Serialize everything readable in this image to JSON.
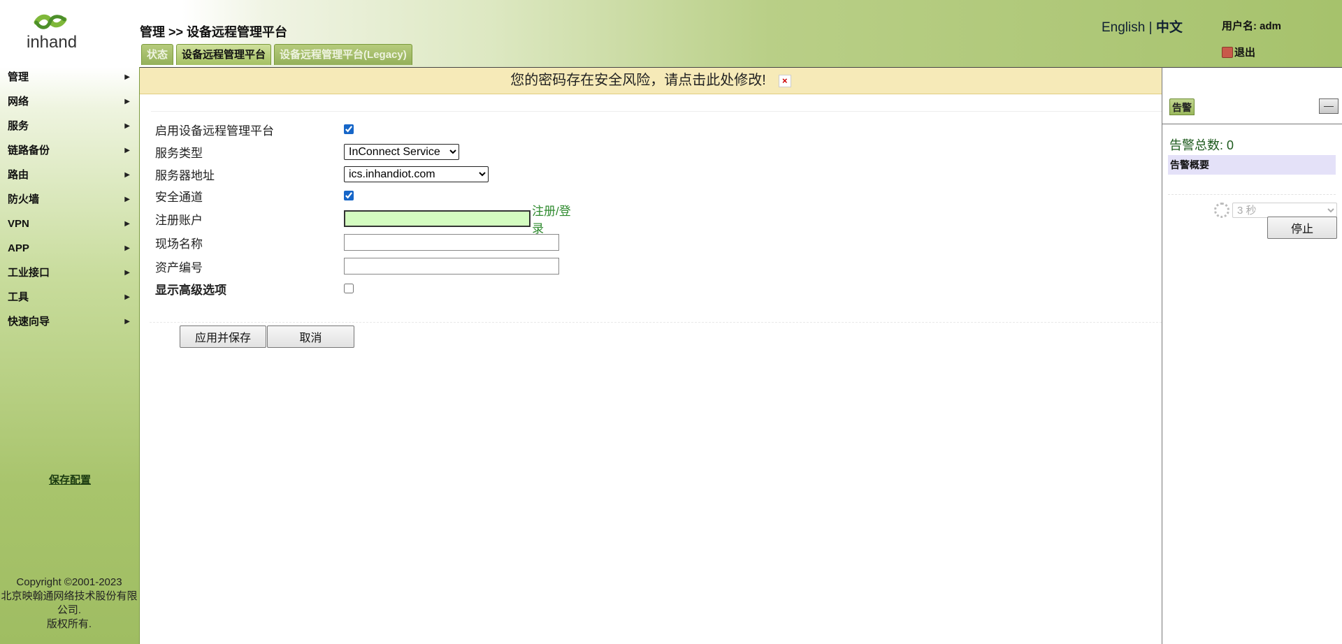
{
  "header": {
    "breadcrumb": "管理 >> 设备远程管理平台",
    "tabs": [
      {
        "label": "状态",
        "active": false
      },
      {
        "label": "设备远程管理平台",
        "active": true
      },
      {
        "label": "设备远程管理平台(Legacy)",
        "active": false
      }
    ],
    "lang_en": "English",
    "lang_sep": " | ",
    "lang_zh": "中文",
    "username": "用户名: adm",
    "logout": "退出",
    "logo_text": "inhand"
  },
  "sidebar": {
    "items": [
      {
        "label": "管理"
      },
      {
        "label": "网络"
      },
      {
        "label": "服务"
      },
      {
        "label": "链路备份"
      },
      {
        "label": "路由"
      },
      {
        "label": "防火墙"
      },
      {
        "label": "VPN"
      },
      {
        "label": "APP"
      },
      {
        "label": "工业接口"
      },
      {
        "label": "工具"
      },
      {
        "label": "快速向导"
      }
    ],
    "save_config": "保存配置",
    "copyright_line1": "Copyright ©2001-2023",
    "copyright_line2": "北京映翰通网络技术股份有限",
    "copyright_line3": "公司.",
    "copyright_line4": "版权所有."
  },
  "alert": {
    "message": "您的密码存在安全风险，请点击此处修改!",
    "close": "×"
  },
  "form": {
    "enable_label": "启用设备远程管理平台",
    "enable_checked": true,
    "service_type_label": "服务类型",
    "service_type_value": "InConnect Service",
    "server_label": "服务器地址",
    "server_value": "ics.inhandiot.com",
    "secure_label": "安全通道",
    "secure_checked": true,
    "account_label": "注册账户",
    "account_value": "",
    "register_link": "注册/登录",
    "site_label": "现场名称",
    "site_value": "",
    "asset_label": "资产编号",
    "asset_value": "",
    "advanced_label": "显示高级选项",
    "advanced_checked": false,
    "apply_label": "应用并保存",
    "cancel_label": "取消"
  },
  "right_panel": {
    "tab_label": "告警",
    "minimize": "—",
    "alarm_total": "告警总数: 0",
    "alarm_summary": "告警概要",
    "interval_value": "3 秒",
    "stop_label": "停止"
  },
  "colors": {
    "header_green": "#a6c26c",
    "alert_bg": "#f6eab8",
    "link_green": "#2e8a2e",
    "input_highlight": "#d4fcc0"
  }
}
